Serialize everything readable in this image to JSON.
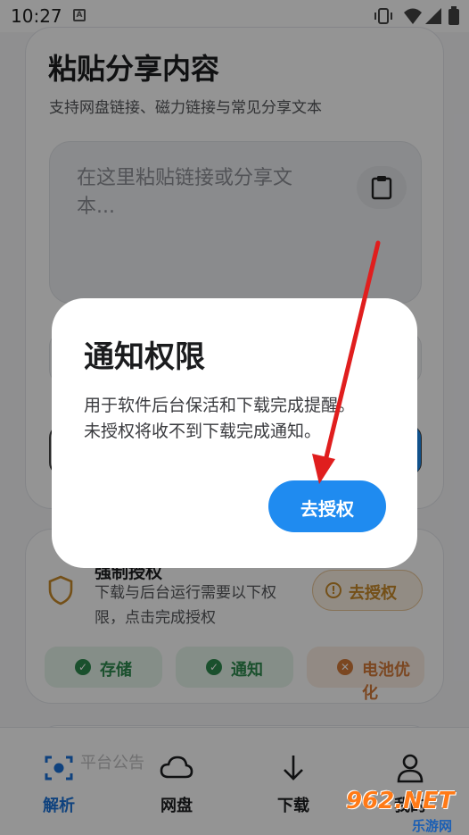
{
  "status_bar": {
    "time": "10:27"
  },
  "paste_card": {
    "title": "粘贴分享内容",
    "subtitle": "支持网盘链接、磁力链接与常见分享文本",
    "placeholder_line1": "在这里粘贴链接或分享文",
    "placeholder_line2": "本..."
  },
  "permission_card": {
    "title": "强制授权",
    "description_line1": "下载与后台运行需要以下权",
    "description_line2": "限，点击完成授权",
    "auth_button_label": "去授权",
    "chips": [
      {
        "label": "存储",
        "status": "granted"
      },
      {
        "label": "通知",
        "status": "granted"
      },
      {
        "label": "电池优化",
        "status": "denied"
      }
    ]
  },
  "announcement": {
    "label": "平台公告"
  },
  "bottom_nav": {
    "items": [
      {
        "label": "解析",
        "icon": "scan-icon",
        "active": true
      },
      {
        "label": "网盘",
        "icon": "cloud-icon",
        "active": false
      },
      {
        "label": "下载",
        "icon": "download-arrow-icon",
        "active": false
      },
      {
        "label": "我的",
        "icon": "person-icon",
        "active": false
      }
    ]
  },
  "dialog": {
    "title": "通知权限",
    "message_line1": "用于软件后台保活和下载完成提醒。",
    "message_line2": "未授权将收不到下载完成通知。",
    "confirm_label": "去授权"
  },
  "watermark": {
    "main": "962.NET",
    "sub": "乐游网"
  },
  "colors": {
    "primary": "#1f8bf0",
    "granted": "#2e8b4f",
    "denied": "#d57a3a",
    "warning": "#c98a2a",
    "annotation": "#e01e1e"
  }
}
